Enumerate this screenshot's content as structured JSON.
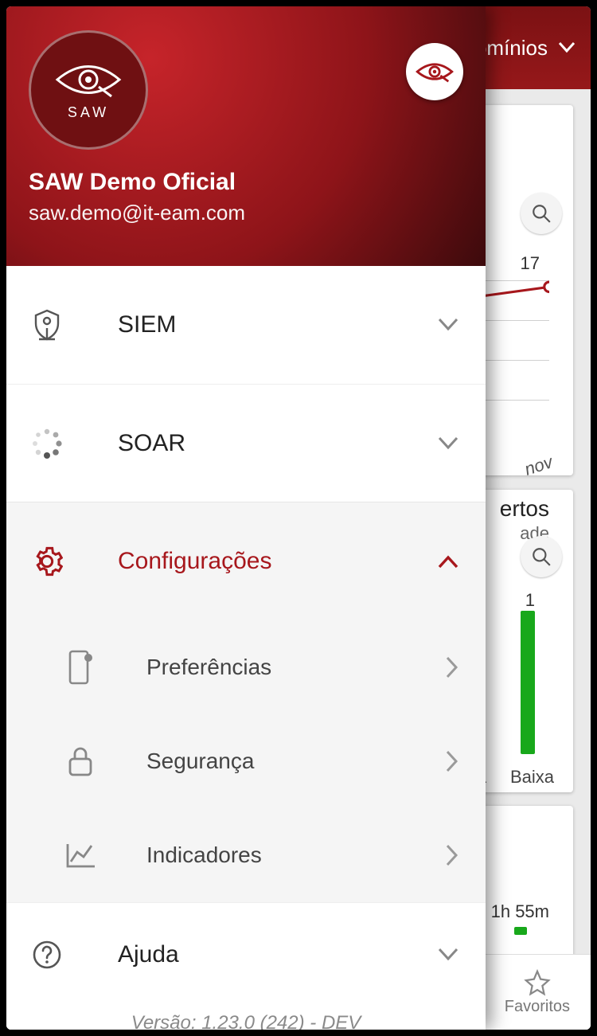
{
  "topbar": {
    "domains_label": "omínios"
  },
  "account": {
    "name": "SAW Demo Oficial",
    "email": "saw.demo@it-eam.com",
    "avatar_text": "SAW"
  },
  "menu": {
    "siem": "SIEM",
    "soar": "SOAR",
    "config": "Configurações",
    "config_sub": {
      "prefs": "Preferências",
      "security": "Segurança",
      "indicators": "Indicadores"
    },
    "help": "Ajuda"
  },
  "version": "Versão: 1.23.0 (242) - DEV",
  "bg": {
    "card1_value": "17",
    "card1_xtick": "nov",
    "card2_title": "ertos",
    "card2_sub": "ade",
    "card2_bar_value": "1",
    "card2_ax_media": "dia",
    "card2_ax_baixa": "Baixa",
    "card3_time": "1h 55m"
  },
  "bottomnav": {
    "favorites": "Favoritos"
  }
}
